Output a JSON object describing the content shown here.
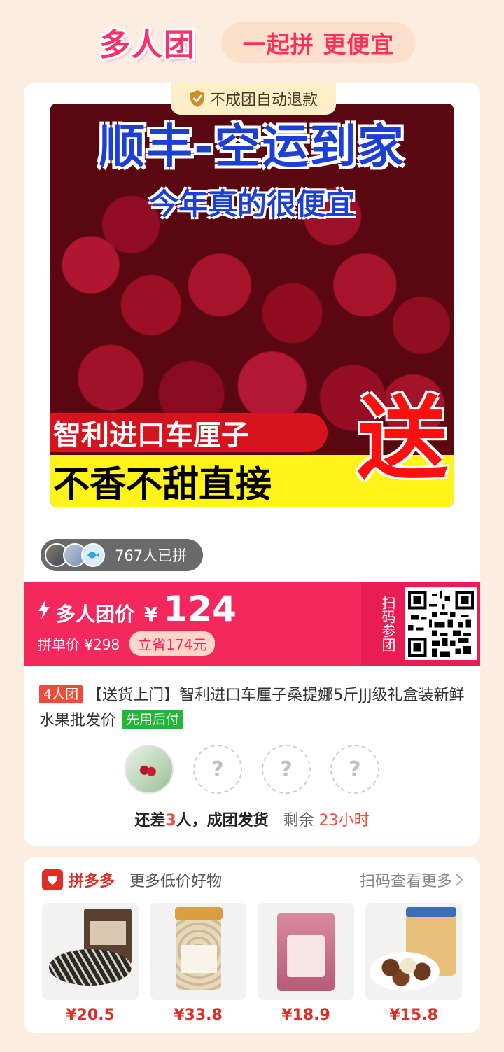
{
  "header": {
    "brand": "多人团",
    "slogan": "一起拼 更便宜"
  },
  "product": {
    "refund_tag": "不成团自动退款",
    "image_text": {
      "title": "顺丰-空运到家",
      "subtitle": "今年真的很便宜",
      "banner1": "智利进口车厘子",
      "banner2": "不香不甜直接",
      "big": "送"
    },
    "joined_text": "767人已拼",
    "price": {
      "label": "多人团价",
      "currency": "¥",
      "amount": "124",
      "single_price": "拼单价 ¥298",
      "saving": "立省174元"
    },
    "scan_label": "扫码参团",
    "team_tag": "4人团",
    "title": "【送货上门】智利进口车厘子桑提娜5斤JJJ级礼盒装新鲜水果批发价",
    "pay_tag": "先用后付",
    "slots": [
      "?",
      "?",
      "?"
    ],
    "status": {
      "prefix": "还差",
      "count": "3",
      "suffix": "人，成团发货",
      "remain_label": "剩余",
      "remain_value": "23小时"
    }
  },
  "recommend": {
    "brand": "拼多多",
    "tagline": "更多低价好物",
    "more": "扫码查看更多",
    "items": [
      {
        "price": "¥20.5"
      },
      {
        "price": "¥33.8"
      },
      {
        "price": "¥18.9"
      },
      {
        "price": "¥15.8"
      }
    ]
  },
  "colors": {
    "accent": "#f5285e",
    "brand_red": "#e02e24",
    "background": "#fbeee0"
  }
}
